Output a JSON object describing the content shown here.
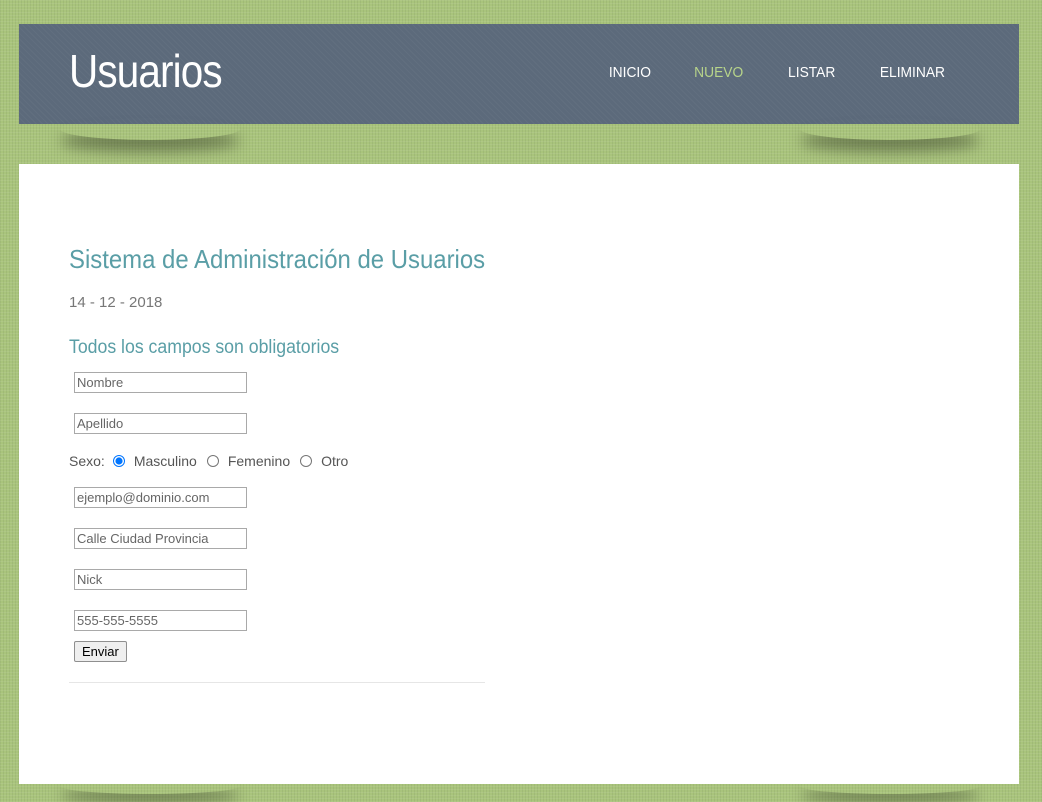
{
  "header": {
    "title": "Usuarios",
    "nav": [
      {
        "label": "INICIO",
        "active": false
      },
      {
        "label": "NUEVO",
        "active": true
      },
      {
        "label": "LISTAR",
        "active": false
      },
      {
        "label": "ELIMINAR",
        "active": false
      }
    ],
    "background_color": "#5c6a7b",
    "active_color": "#b7d48a"
  },
  "main": {
    "heading": "Sistema de Administración de Usuarios",
    "date": "14 - 12 - 2018",
    "subheading": "Todos los campos son obligatorios",
    "accent_color": "#5a9ea6"
  },
  "form": {
    "nombre": {
      "placeholder": "Nombre"
    },
    "apellido": {
      "placeholder": "Apellido"
    },
    "sexo": {
      "label": "Sexo:",
      "options": [
        {
          "label": "Masculino",
          "checked": true
        },
        {
          "label": "Femenino",
          "checked": false
        },
        {
          "label": "Otro",
          "checked": false
        }
      ]
    },
    "email": {
      "placeholder": "ejemplo@dominio.com"
    },
    "direccion": {
      "placeholder": "Calle Ciudad Provincia"
    },
    "nick": {
      "placeholder": "Nick"
    },
    "telefono": {
      "placeholder": "555-555-5555"
    },
    "submit_label": "Enviar"
  },
  "page_background_color": "#a9c47c"
}
